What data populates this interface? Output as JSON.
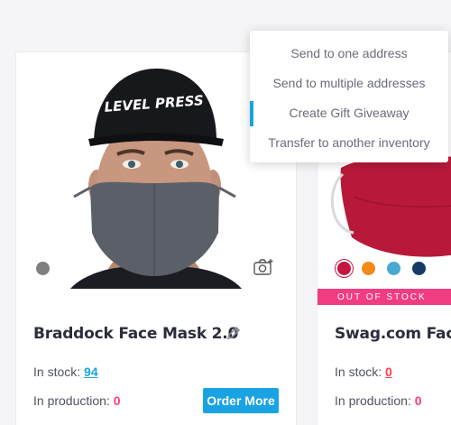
{
  "product_1": {
    "name": "Braddock Face Mask 2.0",
    "hat_text": "LEVEL PRESS",
    "in_stock_label": "In stock:",
    "in_stock_value": "94",
    "in_production_label": "In production:",
    "in_production_value": "0",
    "order_button": "Order More",
    "colors": [
      "#7f7f7f"
    ]
  },
  "product_2": {
    "name": "Swag.com Face",
    "badge": "OUT OF STOCK",
    "in_stock_label": "In stock:",
    "in_stock_value": "0",
    "in_production_label": "In production:",
    "in_production_value": "0",
    "colors": [
      "#c3173f",
      "#f28a18",
      "#49a9d2",
      "#163a63"
    ]
  },
  "menu": {
    "items": [
      {
        "label": "Send to one address"
      },
      {
        "label": "Send to multiple addresses"
      },
      {
        "label": "Create Gift Giveaway"
      },
      {
        "label": "Transfer to another inventory"
      }
    ]
  }
}
